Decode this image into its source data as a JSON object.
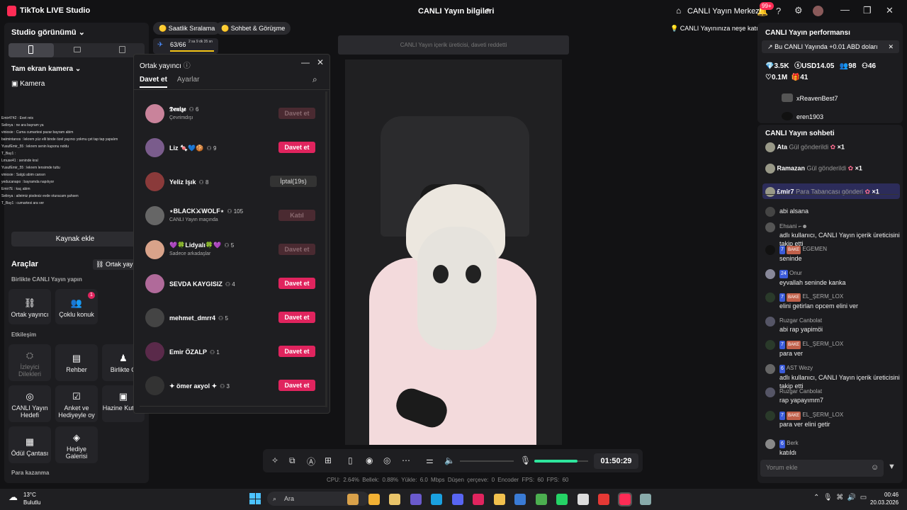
{
  "titlebar": {
    "app": "TikTok LIVE Studio",
    "center": "CANLI Yayın bilgileri",
    "hub": "CANLI Yayın Merkezi",
    "notif_badge": "99+"
  },
  "left": {
    "studio_view": "Studio görünümü",
    "fullscreen_camera": "Tam ekran kamera",
    "camera": "Kamera",
    "chat_lines": [
      "Emir4742 : Evet reis",
      "Selinya : ne ara bayram ya",
      "viniosie : Cuma cumartesi pazar bayram abim",
      "batmintanos : lekrem yüz elli binde özel yayıncı yokmu çet tap tap yapalım",
      "YusufEmir_55 : lekrem senin kuponu noldu",
      "T_Bay1 :",
      "Lmuse41 : seninde kral",
      "YusufEmir_55 : lekrem lensimde tuttu",
      "viniosie : Salgü abim cansın",
      "yeducanapo : bayramda napılıyor",
      "Emir7E : kaç abim",
      "Selinya : aileimiz pisdesiz evde oturacam şahsen",
      "T_Bay1 : cumartesi ara ver"
    ],
    "add_source": "Kaynak ekle",
    "tools": "Araçlar",
    "cohost_link": "Ortak yayın",
    "together": "Birlikte CANLI Yayın yapın",
    "cohost_btn": "Ortak yayıncı",
    "multi_guest": "Çoklu konuk",
    "multi_badge": "1",
    "interaction": "Etkileşim",
    "viewer_req": "İzleyici Dilekleri",
    "guide": "Rehber",
    "together_short": "Birlikte O",
    "goal": "CANLI Yayın Hedefi",
    "poll": "Anket ve Hediyeyle oy",
    "treasure": "Hazine Kutusu",
    "reward": "Ödül Çantası",
    "gift_gallery": "Hediye Galerisi",
    "earn": "Para kazanma"
  },
  "top": {
    "pill1": "Saatlik Sıralama",
    "pill2": "Sohbet & Görüşme",
    "rank": "63/66",
    "rank_time": "2 sa 9 dk 35 sn",
    "pill3": "CANLI Yayınınıza neşe katın",
    "notice": "CANLI Yayın içerik üreticisi, daveti reddetti"
  },
  "popup": {
    "title": "Ortak yayıncı",
    "tab_invite": "Davet et",
    "tab_settings": "Ayarlar",
    "rows": [
      {
        "name": "𝕯𝖊𝖓𝖎𝖟𝖊",
        "count": "6",
        "sub": "Çevrimdışı",
        "btn": "Davet et",
        "state": "off",
        "color": "#c9839b"
      },
      {
        "name": "Liz 🍬💙🍪",
        "count": "9",
        "sub": "",
        "btn": "Davet et",
        "state": "on",
        "color": "#7a5c8c"
      },
      {
        "name": "Yeliz Işık",
        "count": "8",
        "sub": "",
        "btn": "İptal(19s)",
        "state": "cancel",
        "color": "#8a3a3a"
      },
      {
        "name": "⋆BLACK⚔WOLF⋆",
        "count": "105",
        "sub": "CANLI Yayın maçında",
        "btn": "Katıl",
        "state": "off",
        "color": "#666"
      },
      {
        "name": "💜🍀Lidyalı🍀💜",
        "count": "5",
        "sub": "Sadece arkadaşlar",
        "btn": "Davet et",
        "state": "off",
        "color": "#d9a38a"
      },
      {
        "name": "SEVDA KAYGISIZ",
        "count": "4",
        "sub": "",
        "btn": "Davet et",
        "state": "on",
        "color": "#b06a9a"
      },
      {
        "name": "mehmet_dmrr4",
        "count": "5",
        "sub": "",
        "btn": "Davet et",
        "state": "on",
        "color": "#444"
      },
      {
        "name": "Emir ÖZALP",
        "count": "1",
        "sub": "",
        "btn": "Davet et",
        "state": "on",
        "color": "#5a2a4a"
      },
      {
        "name": "✦ ömer aкyol ✦",
        "count": "3",
        "sub": "",
        "btn": "Davet et",
        "state": "on",
        "color": "#333"
      }
    ]
  },
  "bottom": {
    "timer": "01:50:29",
    "volume_pct": 80,
    "stats": "CPU: 2.64%   Bellek: 0.88%   Yükle: 6.0 Mbps   Düşen çerçeve: 0   Encoder FPS: 60   FPS: 60"
  },
  "perf": {
    "title": "CANLI Yayın performansı",
    "banner": "Bu CANLI Yayında +0.01 ABD doları",
    "diamonds": "3.5K",
    "usd": "USD14.05",
    "viewers": "98",
    "followers": "46",
    "likes": "0.1M",
    "gifts": "41",
    "top1": "xReavenBest7",
    "top2": "eren1903"
  },
  "chat": {
    "title": "CANLI Yayın sohbeti",
    "gifts": [
      {
        "name": "Ata",
        "act": "Gül gönderildi",
        "x": "×1"
      },
      {
        "name": "Ramazan",
        "act": "Gül gönderildi",
        "x": "×1"
      },
      {
        "name": "£mir7",
        "act": "Para Tabancası gönderi",
        "x": "×1"
      }
    ],
    "msgs": [
      {
        "user": "",
        "text": "abi alsana",
        "lvl": "",
        "tag": ""
      },
      {
        "user": "Ehsani ⌐☻",
        "text": "adlı kullanıcı, CANLI Yayın içerik üreticisini takip etti",
        "lvl": "",
        "tag": ""
      },
      {
        "user": "EGEMEN",
        "text": "seninde",
        "lvl": "7",
        "tag": "BAKE"
      },
      {
        "user": "Onur",
        "text": "eyvallah seninde kanka",
        "lvl": "24",
        "tag": ""
      },
      {
        "user": "EL_ŞERM_LOX",
        "text": "elini getirlan opcem elini ver",
        "lvl": "7",
        "tag": "BAKE"
      },
      {
        "user": "Ruzgar Canbolat",
        "text": "abi rap yapimöi",
        "lvl": "",
        "tag": ""
      },
      {
        "user": "EL_ŞERM_LOX",
        "text": "para ver",
        "lvl": "7",
        "tag": "BAKE"
      },
      {
        "user": "AST Wezy",
        "text": "adlı kullanıcı, CANLI Yayın içerik üreticisini takip etti",
        "lvl": "6",
        "tag": ""
      },
      {
        "user": "Ruzgar Canbolat",
        "text": "rap yapayımm7",
        "lvl": "",
        "tag": ""
      },
      {
        "user": "EL_ŞERM_LOX",
        "text": "para ver elini getir",
        "lvl": "7",
        "tag": "BAKE"
      },
      {
        "user": "Berk",
        "text": "katıldı",
        "lvl": "6",
        "tag": ""
      }
    ],
    "input_placeholder": "Yorum ekle"
  },
  "taskbar": {
    "temp": "13°C",
    "weather": "Bulutlu",
    "search": "Ara",
    "time": "00:46",
    "date": "20.03.2026"
  }
}
